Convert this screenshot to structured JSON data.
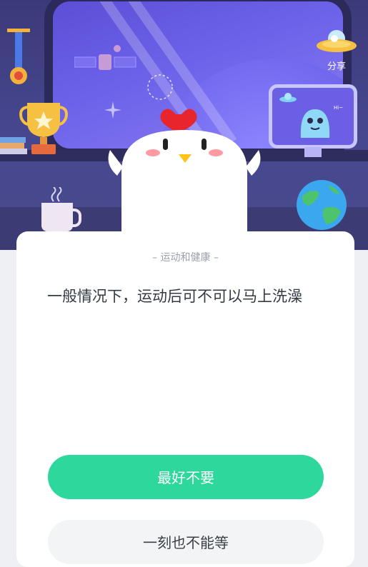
{
  "colors": {
    "primary_button": "#2ed79c",
    "secondary_button": "#f3f4f6",
    "scene_background": "#3b3a79",
    "card_background": "#ffffff"
  },
  "header": {
    "share_label": "分享",
    "share_icon": "ufo-icon"
  },
  "quiz": {
    "category": "运动和健康",
    "question": "一般情况下，运动后可不可以马上洗澡",
    "options": [
      {
        "label": "最好不要"
      },
      {
        "label": "一刻也不能等"
      }
    ]
  }
}
